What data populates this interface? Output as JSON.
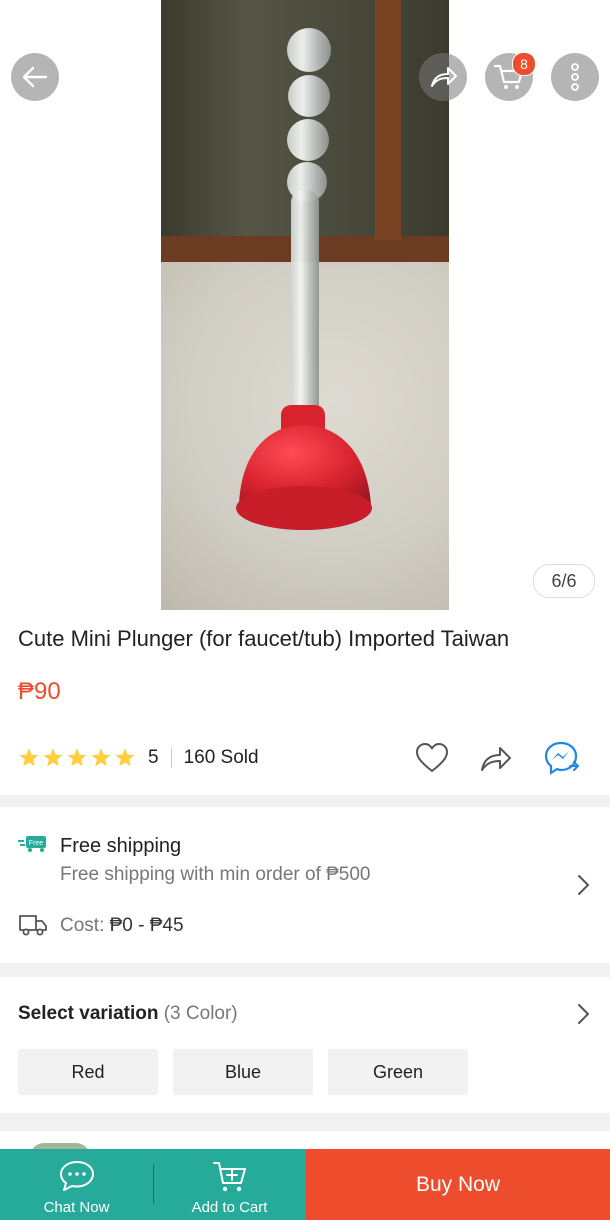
{
  "gallery": {
    "counter": "6/6"
  },
  "header": {
    "cart_count": "8"
  },
  "product": {
    "title": "Cute Mini Plunger (for faucet/tub) Imported Taiwan",
    "price": "₱90",
    "rating": "5",
    "stars": 5,
    "sold": "160 Sold"
  },
  "shipping": {
    "title": "Free shipping",
    "subtitle": "Free shipping with min order of ₱500",
    "cost_label": "Cost: ",
    "cost_value": "₱0 - ₱45",
    "free_tag": "Free"
  },
  "variation": {
    "title": "Select variation",
    "count": "(3 Color)",
    "options": [
      "Red",
      "Blue",
      "Green"
    ]
  },
  "bottom_bar": {
    "chat": "Chat Now",
    "add_to_cart": "Add to Cart",
    "buy_now": "Buy Now"
  },
  "colors": {
    "accent": "#ee4d2d",
    "teal": "#26aa99",
    "star": "#ffce3d"
  }
}
